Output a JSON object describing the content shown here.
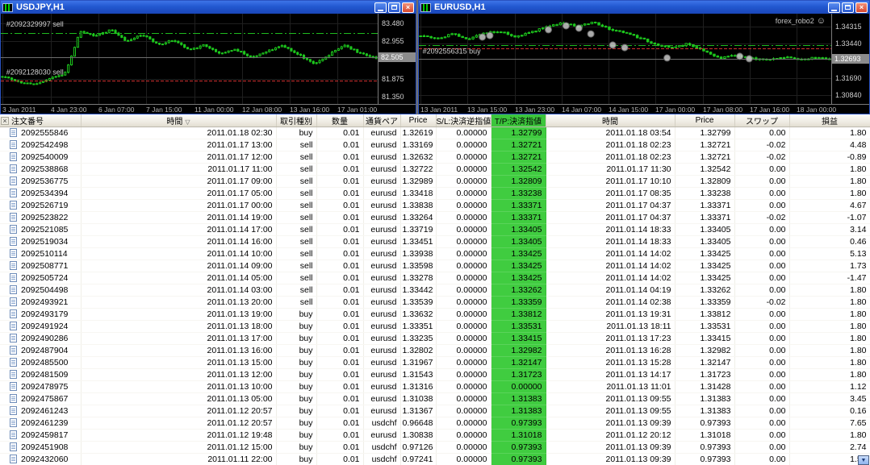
{
  "colors": {
    "candle": "#1DC71D",
    "grid": "#1F1F1F",
    "tp_green": "#40CC40",
    "titlebar_blue": "#2258D0",
    "sell_line_red": "#D03030",
    "chart_bg": "#000000"
  },
  "icons": {
    "close": "×",
    "scroll_down": "▼",
    "sort": "▽",
    "smiley": "☺"
  },
  "windows": {
    "left": {
      "title": "USDJPY,H1",
      "chart": {
        "pmin": 81.15,
        "pmax": 83.75,
        "count": 120,
        "axis": [
          {
            "p": 83.48,
            "label": "83.480"
          },
          {
            "p": 82.955,
            "label": "82.955"
          },
          {
            "p": 81.875,
            "label": "81.875"
          },
          {
            "p": 81.35,
            "label": "81.350"
          }
        ],
        "current": {
          "p": 82.505,
          "label": "82.505"
        },
        "xlabels": [
          {
            "f": 0.005,
            "label": "3 Jan 2011"
          },
          {
            "f": 0.132,
            "label": "4 Jan 23:00"
          },
          {
            "f": 0.259,
            "label": "6 Jan 07:00"
          },
          {
            "f": 0.386,
            "label": "7 Jan 15:00"
          },
          {
            "f": 0.513,
            "label": "11 Jan 00:00"
          },
          {
            "f": 0.64,
            "label": "12 Jan 08:00"
          },
          {
            "f": 0.767,
            "label": "13 Jan 16:00"
          },
          {
            "f": 0.894,
            "label": "17 Jan 01:00"
          }
        ],
        "hlines": [
          {
            "p": 83.2,
            "color": "#1FBA1F",
            "dash": "dashdot"
          },
          {
            "p": 81.83,
            "color": "#D03030",
            "dash": "dashed"
          },
          {
            "p": 82.505,
            "color": "#6E6E6E",
            "dash": "solid"
          }
        ],
        "annotations": [
          {
            "f": 0.01,
            "p": 83.33,
            "text": "#2092329997 sell"
          },
          {
            "f": 0.01,
            "p": 81.95,
            "text": "#2092128030 sell"
          }
        ],
        "anchors": [
          81.95,
          81.8,
          81.7,
          81.88,
          82.0,
          83.25,
          83.1,
          83.3,
          82.95,
          83.15,
          82.85,
          83.0,
          82.7,
          82.85,
          82.6,
          82.72,
          82.5,
          82.66,
          82.82,
          82.58,
          82.3,
          82.58,
          82.85,
          82.6,
          82.48
        ],
        "markers": []
      }
    },
    "right": {
      "title": "EURUSD,H1",
      "ea_label": "forex_robo2",
      "chart": {
        "pmin": 1.304,
        "pmax": 1.3495,
        "count": 118,
        "axis": [
          {
            "p": 1.34315,
            "label": "1.34315"
          },
          {
            "p": 1.3344,
            "label": "1.33440"
          },
          {
            "p": 1.3169,
            "label": "1.31690"
          },
          {
            "p": 1.3084,
            "label": "1.30840"
          }
        ],
        "current": {
          "p": 1.32693,
          "label": "1.32693"
        },
        "xlabels": [
          {
            "f": 0.004,
            "label": "13 Jan 2011"
          },
          {
            "f": 0.118,
            "label": "13 Jan 15:00"
          },
          {
            "f": 0.232,
            "label": "13 Jan 23:00"
          },
          {
            "f": 0.346,
            "label": "14 Jan 07:00"
          },
          {
            "f": 0.46,
            "label": "14 Jan 15:00"
          },
          {
            "f": 0.574,
            "label": "17 Jan 00:00"
          },
          {
            "f": 0.688,
            "label": "17 Jan 08:00"
          },
          {
            "f": 0.802,
            "label": "17 Jan 16:00"
          },
          {
            "f": 0.916,
            "label": "18 Jan 00:00"
          }
        ],
        "hlines": [
          {
            "p": 1.3338,
            "color": "#1FBA1F",
            "dash": "dashdot"
          },
          {
            "p": 1.3322,
            "color": "#D03030",
            "dash": "dashed"
          },
          {
            "p": 1.32693,
            "color": "#6E6E6E",
            "dash": "solid"
          }
        ],
        "annotations": [
          {
            "f": 0.005,
            "p": 1.3285,
            "text": "#2092556315 buy"
          }
        ],
        "anchors": [
          1.3385,
          1.337,
          1.3392,
          1.3368,
          1.3395,
          1.3408,
          1.3378,
          1.34,
          1.3432,
          1.3448,
          1.343,
          1.3452,
          1.3418,
          1.34,
          1.337,
          1.334,
          1.3322,
          1.3345,
          1.331,
          1.3268,
          1.3285,
          1.327,
          1.3262,
          1.3278,
          1.3265,
          1.3272,
          1.3268
        ],
        "markers": [
          [
            0.154,
            1.3377
          ],
          [
            0.172,
            1.3385
          ],
          [
            0.314,
            1.3414
          ],
          [
            0.357,
            1.3434
          ],
          [
            0.388,
            1.3422
          ],
          [
            0.417,
            1.3393
          ],
          [
            0.47,
            1.3337
          ],
          [
            0.499,
            1.3324
          ],
          [
            0.602,
            1.3272
          ],
          [
            0.778,
            1.328
          ],
          [
            0.801,
            1.3268
          ]
        ]
      }
    }
  },
  "terminal": {
    "columns": [
      "注文番号",
      "時間",
      "取引種別",
      "数量",
      "通貨ペア",
      "Price",
      "S/L:決済逆指値",
      "T/P:決済指値",
      "時間",
      "Price",
      "スワップ",
      "損益"
    ],
    "rows": [
      [
        "2092555846",
        "2011.01.18 02:30",
        "buy",
        "0.01",
        "eurusd",
        "1.32619",
        "0.00000",
        "1.32799",
        "2011.01.18 03:54",
        "1.32799",
        "0.00",
        "1.80"
      ],
      [
        "2092542498",
        "2011.01.17 13:00",
        "sell",
        "0.01",
        "eurusd",
        "1.33169",
        "0.00000",
        "1.32721",
        "2011.01.18 02:23",
        "1.32721",
        "-0.02",
        "4.48"
      ],
      [
        "2092540009",
        "2011.01.17 12:00",
        "sell",
        "0.01",
        "eurusd",
        "1.32632",
        "0.00000",
        "1.32721",
        "2011.01.18 02:23",
        "1.32721",
        "-0.02",
        "-0.89"
      ],
      [
        "2092538868",
        "2011.01.17 11:00",
        "sell",
        "0.01",
        "eurusd",
        "1.32722",
        "0.00000",
        "1.32542",
        "2011.01.17 11:30",
        "1.32542",
        "0.00",
        "1.80"
      ],
      [
        "2092536775",
        "2011.01.17 09:00",
        "sell",
        "0.01",
        "eurusd",
        "1.32989",
        "0.00000",
        "1.32809",
        "2011.01.17 10:10",
        "1.32809",
        "0.00",
        "1.80"
      ],
      [
        "2092534394",
        "2011.01.17 05:00",
        "sell",
        "0.01",
        "eurusd",
        "1.33418",
        "0.00000",
        "1.33238",
        "2011.01.17 08:35",
        "1.33238",
        "0.00",
        "1.80"
      ],
      [
        "2092526719",
        "2011.01.17 00:00",
        "sell",
        "0.01",
        "eurusd",
        "1.33838",
        "0.00000",
        "1.33371",
        "2011.01.17 04:37",
        "1.33371",
        "0.00",
        "4.67"
      ],
      [
        "2092523822",
        "2011.01.14 19:00",
        "sell",
        "0.01",
        "eurusd",
        "1.33264",
        "0.00000",
        "1.33371",
        "2011.01.17 04:37",
        "1.33371",
        "-0.02",
        "-1.07"
      ],
      [
        "2092521085",
        "2011.01.14 17:00",
        "sell",
        "0.01",
        "eurusd",
        "1.33719",
        "0.00000",
        "1.33405",
        "2011.01.14 18:33",
        "1.33405",
        "0.00",
        "3.14"
      ],
      [
        "2092519034",
        "2011.01.14 16:00",
        "sell",
        "0.01",
        "eurusd",
        "1.33451",
        "0.00000",
        "1.33405",
        "2011.01.14 18:33",
        "1.33405",
        "0.00",
        "0.46"
      ],
      [
        "2092510114",
        "2011.01.14 10:00",
        "sell",
        "0.01",
        "eurusd",
        "1.33938",
        "0.00000",
        "1.33425",
        "2011.01.14 14:02",
        "1.33425",
        "0.00",
        "5.13"
      ],
      [
        "2092508771",
        "2011.01.14 09:00",
        "sell",
        "0.01",
        "eurusd",
        "1.33598",
        "0.00000",
        "1.33425",
        "2011.01.14 14:02",
        "1.33425",
        "0.00",
        "1.73"
      ],
      [
        "2092505724",
        "2011.01.14 05:00",
        "sell",
        "0.01",
        "eurusd",
        "1.33278",
        "0.00000",
        "1.33425",
        "2011.01.14 14:02",
        "1.33425",
        "0.00",
        "-1.47"
      ],
      [
        "2092504498",
        "2011.01.14 03:00",
        "sell",
        "0.01",
        "eurusd",
        "1.33442",
        "0.00000",
        "1.33262",
        "2011.01.14 04:19",
        "1.33262",
        "0.00",
        "1.80"
      ],
      [
        "2092493921",
        "2011.01.13 20:00",
        "sell",
        "0.01",
        "eurusd",
        "1.33539",
        "0.00000",
        "1.33359",
        "2011.01.14 02:38",
        "1.33359",
        "-0.02",
        "1.80"
      ],
      [
        "2092493179",
        "2011.01.13 19:00",
        "buy",
        "0.01",
        "eurusd",
        "1.33632",
        "0.00000",
        "1.33812",
        "2011.01.13 19:31",
        "1.33812",
        "0.00",
        "1.80"
      ],
      [
        "2092491924",
        "2011.01.13 18:00",
        "buy",
        "0.01",
        "eurusd",
        "1.33351",
        "0.00000",
        "1.33531",
        "2011.01.13 18:11",
        "1.33531",
        "0.00",
        "1.80"
      ],
      [
        "2092490286",
        "2011.01.13 17:00",
        "buy",
        "0.01",
        "eurusd",
        "1.33235",
        "0.00000",
        "1.33415",
        "2011.01.13 17:23",
        "1.33415",
        "0.00",
        "1.80"
      ],
      [
        "2092487904",
        "2011.01.13 16:00",
        "buy",
        "0.01",
        "eurusd",
        "1.32802",
        "0.00000",
        "1.32982",
        "2011.01.13 16:28",
        "1.32982",
        "0.00",
        "1.80"
      ],
      [
        "2092485500",
        "2011.01.13 15:00",
        "buy",
        "0.01",
        "eurusd",
        "1.31967",
        "0.00000",
        "1.32147",
        "2011.01.13 15:28",
        "1.32147",
        "0.00",
        "1.80"
      ],
      [
        "2092481509",
        "2011.01.13 12:00",
        "buy",
        "0.01",
        "eurusd",
        "1.31543",
        "0.00000",
        "1.31723",
        "2011.01.13 14:17",
        "1.31723",
        "0.00",
        "1.80"
      ],
      [
        "2092478975",
        "2011.01.13 10:00",
        "buy",
        "0.01",
        "eurusd",
        "1.31316",
        "0.00000",
        "0.00000",
        "2011.01.13 11:01",
        "1.31428",
        "0.00",
        "1.12"
      ],
      [
        "2092475867",
        "2011.01.13 05:00",
        "buy",
        "0.01",
        "eurusd",
        "1.31038",
        "0.00000",
        "1.31383",
        "2011.01.13 09:55",
        "1.31383",
        "0.00",
        "3.45"
      ],
      [
        "2092461243",
        "2011.01.12 20:57",
        "buy",
        "0.01",
        "eurusd",
        "1.31367",
        "0.00000",
        "1.31383",
        "2011.01.13 09:55",
        "1.31383",
        "0.00",
        "0.16"
      ],
      [
        "2092461239",
        "2011.01.12 20:57",
        "buy",
        "0.01",
        "usdchf",
        "0.96648",
        "0.00000",
        "0.97393",
        "2011.01.13 09:39",
        "0.97393",
        "0.00",
        "7.65"
      ],
      [
        "2092459817",
        "2011.01.12 19:48",
        "buy",
        "0.01",
        "eurusd",
        "1.30838",
        "0.00000",
        "1.31018",
        "2011.01.12 20:12",
        "1.31018",
        "0.00",
        "1.80"
      ],
      [
        "2092451908",
        "2011.01.12 15:00",
        "buy",
        "0.01",
        "usdchf",
        "0.97126",
        "0.00000",
        "0.97393",
        "2011.01.13 09:39",
        "0.97393",
        "0.00",
        "2.74"
      ],
      [
        "2092432060",
        "2011.01.11 22:00",
        "buy",
        "0.01",
        "usdchf",
        "0.97241",
        "0.00000",
        "0.97393",
        "2011.01.13 09:39",
        "0.97393",
        "0.00",
        "1.52"
      ]
    ]
  }
}
